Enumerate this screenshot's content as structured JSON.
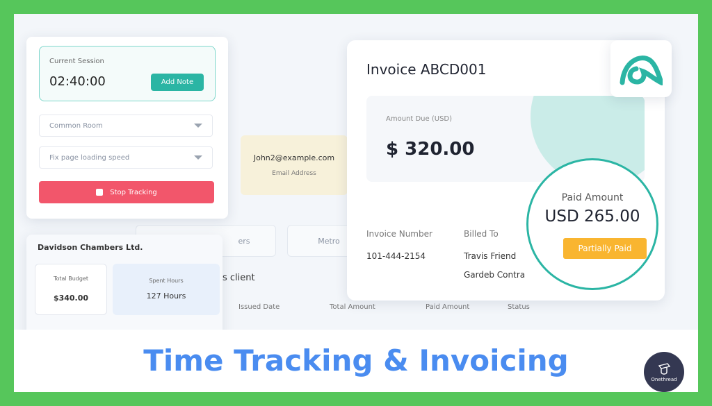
{
  "session": {
    "label": "Current Session",
    "time": "02:40:00",
    "add_note": "Add Note",
    "room": "Common Room",
    "task": "Fix page loading speed",
    "stop": "Stop Tracking"
  },
  "email": {
    "value": "John2@example.com",
    "label": "Email Address"
  },
  "client": {
    "name": "Davidson Chambers Ltd.",
    "budget_label": "Total Budget",
    "budget": "$340.00",
    "hours_label": "Spent Hours",
    "hours": "127 Hours"
  },
  "background": {
    "field1": "ers",
    "field2": "Metro",
    "client_heading": "s client",
    "columns": [
      "Issued Date",
      "Total Amount",
      "Paid Amount",
      "Status"
    ]
  },
  "invoice": {
    "title": "Invoice ABCD001",
    "amount_due_label": "Amount Due (USD)",
    "amount_due": "$ 320.00",
    "number_label": "Invoice Number",
    "number": "101-444-2154",
    "billed_label": "Billed To",
    "billed_name": "Travis Friend",
    "billed_company": "Gardeb Contra",
    "paid_label": "Paid Amount",
    "paid": "USD 265.00",
    "status": "Partially Paid"
  },
  "colors": {
    "accent": "#2bb5a4",
    "stop": "#f2566b",
    "status": "#f9b530",
    "headline": "#4a8cf0",
    "border": "#56c65b"
  },
  "headline": "Time Tracking & Invoicing",
  "brand": "Onethread"
}
